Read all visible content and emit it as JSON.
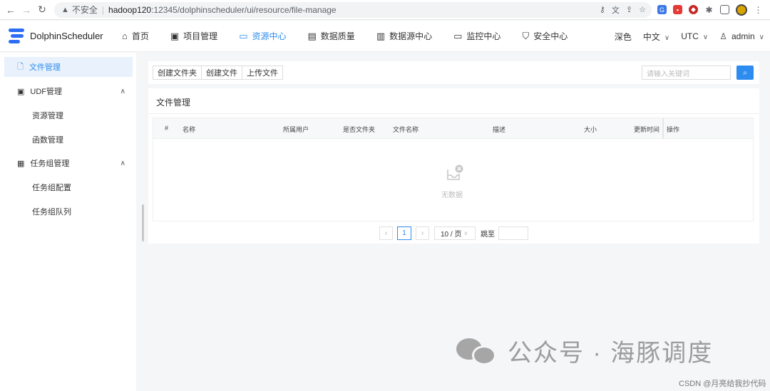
{
  "browser": {
    "insecure_label": "不安全",
    "url_host": "hadoop120",
    "url_path": ":12345/dolphinscheduler/ui/resource/file-manage"
  },
  "header": {
    "app_name": "DolphinScheduler",
    "menu": [
      {
        "label": "首页",
        "icon": "home-icon"
      },
      {
        "label": "项目管理",
        "icon": "project-icon"
      },
      {
        "label": "资源中心",
        "icon": "folder-icon"
      },
      {
        "label": "数据质量",
        "icon": "data-quality-icon"
      },
      {
        "label": "数据源中心",
        "icon": "datasource-icon"
      },
      {
        "label": "监控中心",
        "icon": "monitor-icon"
      },
      {
        "label": "安全中心",
        "icon": "shield-icon"
      }
    ],
    "active_menu": "资源中心",
    "theme": "深色",
    "language": "中文",
    "timezone": "UTC",
    "user": "admin",
    "accent_color": "#2d8cf0"
  },
  "sidebar": {
    "items": [
      {
        "label": "文件管理",
        "icon": "file-manage-icon"
      },
      {
        "label": "UDF管理",
        "icon": "udf-icon"
      },
      {
        "label": "资源管理"
      },
      {
        "label": "函数管理"
      },
      {
        "label": "任务组管理",
        "icon": "task-group-icon"
      },
      {
        "label": "任务组配置"
      },
      {
        "label": "任务组队列"
      }
    ]
  },
  "toolbar": {
    "create_folder": "创建文件夹",
    "create_file": "创建文件",
    "upload_file": "上传文件",
    "search_placeholder": "请输入关键词"
  },
  "card": {
    "title": "文件管理",
    "columns": [
      "#",
      "名称",
      "所属用户",
      "是否文件夹",
      "文件名称",
      "描述",
      "大小",
      "更新时间",
      "操作"
    ],
    "empty_text": "无数据"
  },
  "pager": {
    "current_page": "1",
    "page_size": "10 / 页",
    "jump_label": "跳至"
  },
  "watermark": {
    "text": "公众号 · 海豚调度",
    "credit": "CSDN @月亮给我抄代码"
  }
}
